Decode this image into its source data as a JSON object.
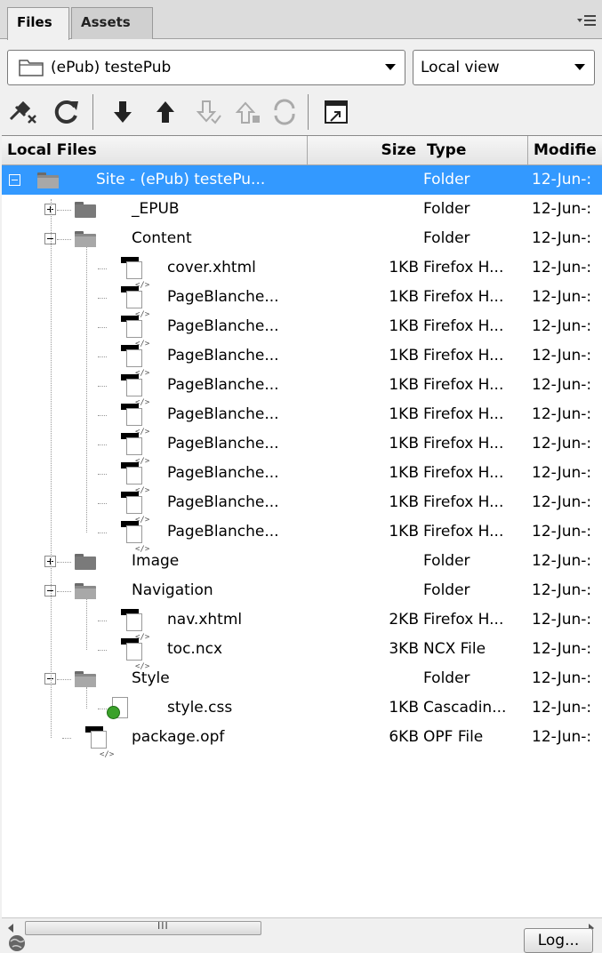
{
  "tabs": [
    {
      "label": "Files",
      "active": true
    },
    {
      "label": "Assets",
      "active": false
    }
  ],
  "site_select": {
    "value": "(ePub) testePub",
    "icon": "folder-outline-icon"
  },
  "view_select": {
    "value": "Local view"
  },
  "toolbar": {
    "buttons": [
      "connect-icon",
      "refresh-icon",
      "get-icon",
      "put-icon",
      "check-out-icon",
      "check-in-icon",
      "sync-icon",
      "expand-icon"
    ]
  },
  "columns": {
    "name": "Local Files",
    "size": "Size",
    "type": "Type",
    "modified": "Modifie"
  },
  "rows": [
    {
      "name": "Site - (ePub) testePu...",
      "size": "",
      "type": "Folder",
      "modified": "12-Jun-:",
      "kind": "folder-open",
      "depth": 0,
      "toggle": "minus",
      "selected": true
    },
    {
      "name": "_EPUB",
      "size": "",
      "type": "Folder",
      "modified": "12-Jun-:",
      "kind": "folder",
      "depth": 1,
      "toggle": "plus"
    },
    {
      "name": "Content",
      "size": "",
      "type": "Folder",
      "modified": "12-Jun-:",
      "kind": "folder-open",
      "depth": 1,
      "toggle": "minus"
    },
    {
      "name": "cover.xhtml",
      "size": "1KB",
      "type": "Firefox H...",
      "modified": "12-Jun-:",
      "kind": "file",
      "depth": 2
    },
    {
      "name": "PageBlanche...",
      "size": "1KB",
      "type": "Firefox H...",
      "modified": "12-Jun-:",
      "kind": "file",
      "depth": 2
    },
    {
      "name": "PageBlanche...",
      "size": "1KB",
      "type": "Firefox H...",
      "modified": "12-Jun-:",
      "kind": "file",
      "depth": 2
    },
    {
      "name": "PageBlanche...",
      "size": "1KB",
      "type": "Firefox H...",
      "modified": "12-Jun-:",
      "kind": "file",
      "depth": 2
    },
    {
      "name": "PageBlanche...",
      "size": "1KB",
      "type": "Firefox H...",
      "modified": "12-Jun-:",
      "kind": "file",
      "depth": 2
    },
    {
      "name": "PageBlanche...",
      "size": "1KB",
      "type": "Firefox H...",
      "modified": "12-Jun-:",
      "kind": "file",
      "depth": 2
    },
    {
      "name": "PageBlanche...",
      "size": "1KB",
      "type": "Firefox H...",
      "modified": "12-Jun-:",
      "kind": "file",
      "depth": 2
    },
    {
      "name": "PageBlanche...",
      "size": "1KB",
      "type": "Firefox H...",
      "modified": "12-Jun-:",
      "kind": "file",
      "depth": 2
    },
    {
      "name": "PageBlanche...",
      "size": "1KB",
      "type": "Firefox H...",
      "modified": "12-Jun-:",
      "kind": "file",
      "depth": 2
    },
    {
      "name": "PageBlanche...",
      "size": "1KB",
      "type": "Firefox H...",
      "modified": "12-Jun-:",
      "kind": "file",
      "depth": 2
    },
    {
      "name": "Image",
      "size": "",
      "type": "Folder",
      "modified": "12-Jun-:",
      "kind": "folder",
      "depth": 1,
      "toggle": "plus"
    },
    {
      "name": "Navigation",
      "size": "",
      "type": "Folder",
      "modified": "12-Jun-:",
      "kind": "folder-open",
      "depth": 1,
      "toggle": "minus"
    },
    {
      "name": "nav.xhtml",
      "size": "2KB",
      "type": "Firefox H...",
      "modified": "12-Jun-:",
      "kind": "file",
      "depth": 2
    },
    {
      "name": "toc.ncx",
      "size": "3KB",
      "type": "NCX File",
      "modified": "12-Jun-:",
      "kind": "file",
      "depth": 2
    },
    {
      "name": "Style",
      "size": "",
      "type": "Folder",
      "modified": "12-Jun-:",
      "kind": "folder-open",
      "depth": 1,
      "toggle": "minus"
    },
    {
      "name": "style.css",
      "size": "1KB",
      "type": "Cascadin...",
      "modified": "12-Jun-:",
      "kind": "css",
      "depth": 2
    },
    {
      "name": "package.opf",
      "size": "6KB",
      "type": "OPF File",
      "modified": "12-Jun-:",
      "kind": "file",
      "depth": 1
    }
  ],
  "scrollbar": {
    "grip": "III"
  },
  "status": {
    "log_label": "Log..."
  },
  "colors": {
    "selection": "#3399ff",
    "panel_bg": "#f0f0f0"
  }
}
